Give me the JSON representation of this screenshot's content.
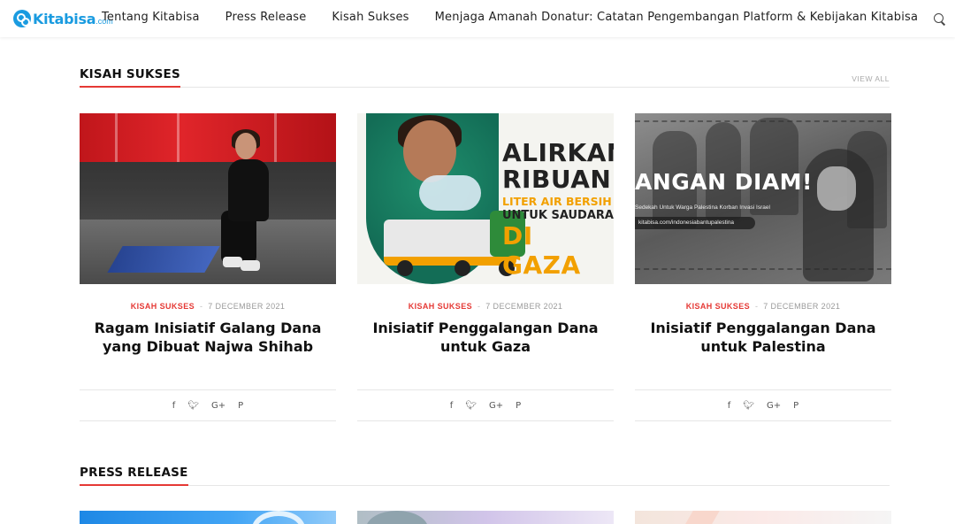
{
  "brand": {
    "name": "Kitabisa",
    "suffix": ".com",
    "color": "#1a9be0"
  },
  "nav": {
    "items": [
      "Tentang Kitabisa",
      "Press Release",
      "Kisah Sukses",
      "Menjaga Amanah Donatur: Catatan Pengembangan Platform & Kebijakan Kitabisa"
    ]
  },
  "sections": {
    "kisah_sukses": {
      "title": "KISAH SUKSES",
      "view_all": "VIEW ALL",
      "accent": "#e53935"
    },
    "press_release": {
      "title": "PRESS RELEASE"
    }
  },
  "cards": [
    {
      "category": "KISAH SUKSES",
      "separator": "-",
      "date": "7 DECEMBER 2021",
      "title": "Ragam Inisiatif Galang Dana yang Dibuat Najwa Shihab"
    },
    {
      "category": "KISAH SUKSES",
      "separator": "-",
      "date": "7 DECEMBER 2021",
      "title": "Inisiatif Penggalangan Dana untuk Gaza",
      "image_text": [
        "ALIRKAN",
        "RIBUAN",
        "LITER AIR BERSIH",
        "UNTUK SAUDARA",
        "DI GAZA"
      ]
    },
    {
      "category": "KISAH SUKSES",
      "separator": "-",
      "date": "7 DECEMBER 2021",
      "title": "Inisiatif Penggalangan Dana untuk Palestina",
      "image_text": [
        "ANGAN DIAM!",
        "Sedekah Untuk Warga Palestina Korban Invasi Israel",
        "kitabisa.com/indonesiabantupalestina"
      ]
    }
  ],
  "share": {
    "facebook": "f",
    "twitter": "♥",
    "google_plus": "G+",
    "pinterest": "P"
  },
  "icons": {
    "search": "search-icon",
    "facebook": "facebook-icon",
    "twitter": "twitter-icon",
    "google_plus": "google-plus-icon",
    "pinterest": "pinterest-icon"
  }
}
